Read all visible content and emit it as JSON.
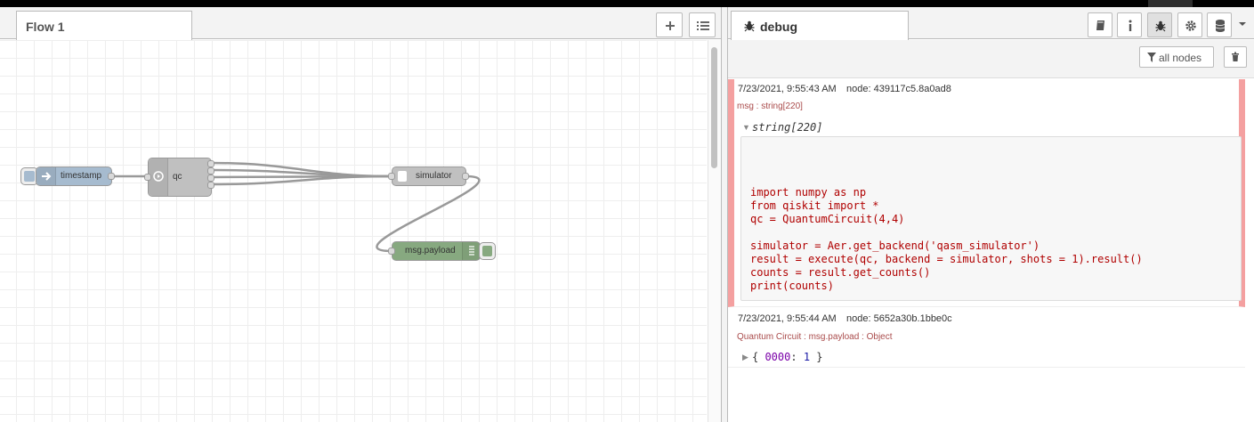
{
  "workspace": {
    "tab_title": "Flow 1",
    "nodes": {
      "inject": {
        "label": "timestamp"
      },
      "function": {
        "label": "qc"
      },
      "simulator": {
        "label": "simulator"
      },
      "debug": {
        "label": "msg.payload"
      }
    }
  },
  "sidebar": {
    "tab_title": "debug",
    "filter_label": "all nodes",
    "messages": [
      {
        "timestamp": "7/23/2021, 9:55:43 AM",
        "node": "node: 439117c5.8a0ad8",
        "name": "msg : string[220]",
        "type_label": "string[220]",
        "code_lines": [
          "import numpy as np",
          "from qiskit import *",
          "qc = QuantumCircuit(4,4)",
          "",
          "simulator = Aer.get_backend('qasm_simulator')",
          "result = execute(qc, backend = simulator, shots = 1).result()",
          "counts = result.get_counts()",
          "print(counts)"
        ]
      },
      {
        "timestamp": "7/23/2021, 9:55:44 AM",
        "node": "node: 5652a30b.1bbe0c",
        "name": "Quantum Circuit : msg.payload : Object",
        "object_open": "{ ",
        "object_key": "0000",
        "object_sep": ": ",
        "object_value": "1",
        "object_close": " }"
      }
    ]
  },
  "colors": {
    "inject_node": "#a6bbcf",
    "function_node": "#c0c0c0",
    "debug_node": "#87a980",
    "error_bar": "#f4a0a0",
    "code_text": "#b00000"
  }
}
